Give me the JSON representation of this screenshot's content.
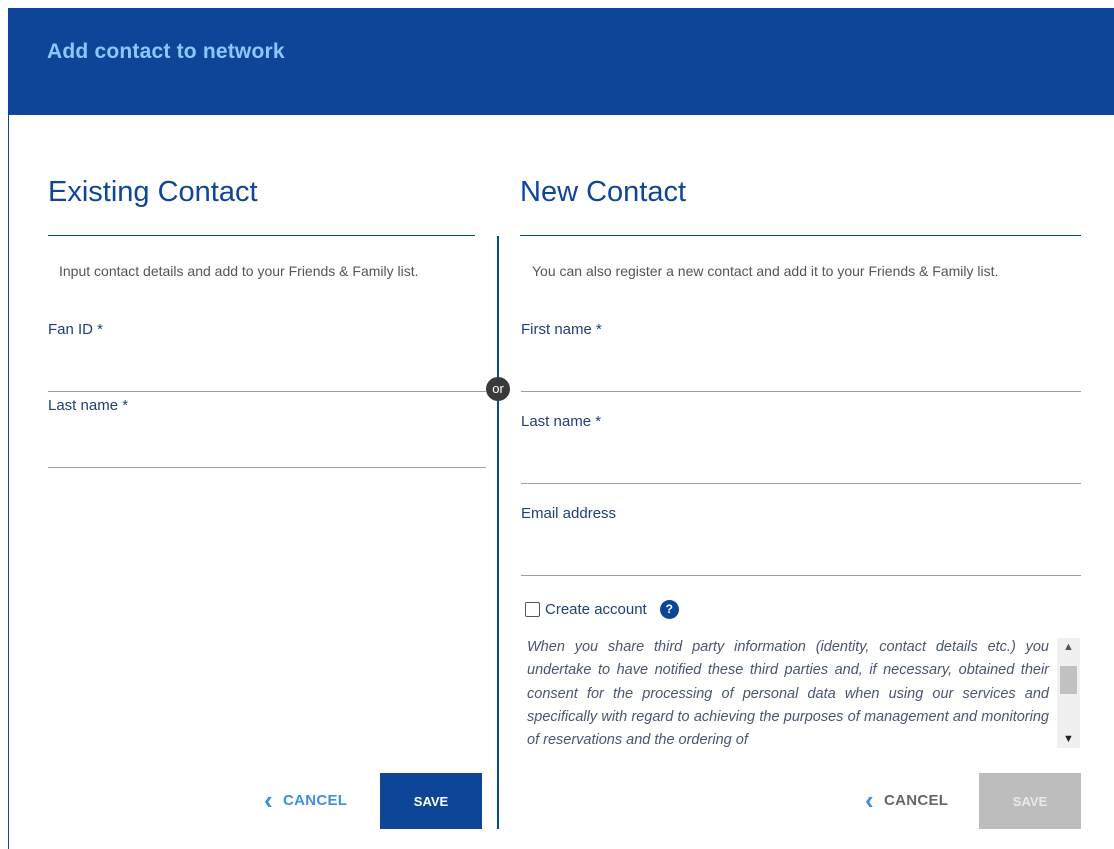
{
  "header": {
    "title": "Add contact to network"
  },
  "existing": {
    "title": "Existing Contact",
    "description": "Input contact details and add to your Friends & Family list.",
    "fan_id_label": "Fan ID *",
    "last_name_label": "Last name *",
    "cancel_label": "CANCEL",
    "save_label": "SAVE"
  },
  "separator": {
    "label": "or"
  },
  "new_contact": {
    "title": "New Contact",
    "description": "You can also register a new contact and add it to your Friends & Family list.",
    "first_name_label": "First name  *",
    "last_name_label": "Last name  *",
    "email_label": "Email address",
    "create_account_label": "Create account",
    "help_glyph": "?",
    "notice": "When you share third party information (identity, contact details etc.) you undertake to have notified these third parties and, if necessary, obtained their consent for the processing of personal data when using our services and specifically with regard to achieving the purposes of management and monitoring of reservations and the ordering of",
    "cancel_label": "CANCEL",
    "save_label": "SAVE"
  },
  "colors": {
    "brand": "#0d4699",
    "header_title": "#8ec7ff",
    "cancel_text_active": "#3f8ee0",
    "cancel_text_inactive": "#666666",
    "save_disabled": "#bdbdbd"
  },
  "icons": {
    "cancel_icon": "chevron-left-icon",
    "help_icon": "question-circle-icon",
    "scroll_up": "arrow-up-icon",
    "scroll_down": "arrow-down-icon"
  }
}
